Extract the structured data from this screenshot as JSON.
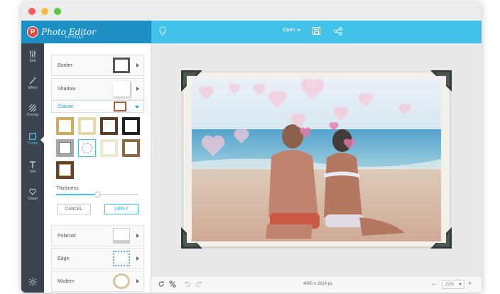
{
  "app": {
    "name": "Photo Editor",
    "sub": "FOTOJET"
  },
  "topbar": {
    "open_label": "Open"
  },
  "nav": [
    {
      "label": "Edit",
      "icon": "sliders-icon"
    },
    {
      "label": "Effect",
      "icon": "magic-wand-icon"
    },
    {
      "label": "Overlay",
      "icon": "stripes-icon"
    },
    {
      "label": "Frame",
      "icon": "frame-icon"
    },
    {
      "label": "Text",
      "icon": "text-icon"
    },
    {
      "label": "Clipart",
      "icon": "heart-icon"
    }
  ],
  "panel": {
    "border_label": "Border",
    "shadow_label": "Shadow",
    "classic_label": "Classic",
    "thickness_label": "Thickness",
    "thickness_value": "50",
    "thickness_fraction": 0.5,
    "cancel_label": "CANCEL",
    "apply_label": "APPLY",
    "polaroid_label": "Polaroid",
    "edge_label": "Edge",
    "modern_label": "Modern"
  },
  "status": {
    "dimensions": "4000 x 2814 px",
    "zoom": "22%"
  },
  "colors": {
    "accent": "#41c3e9",
    "brand": "#1e8fc4",
    "sidebar": "#3c4450"
  }
}
